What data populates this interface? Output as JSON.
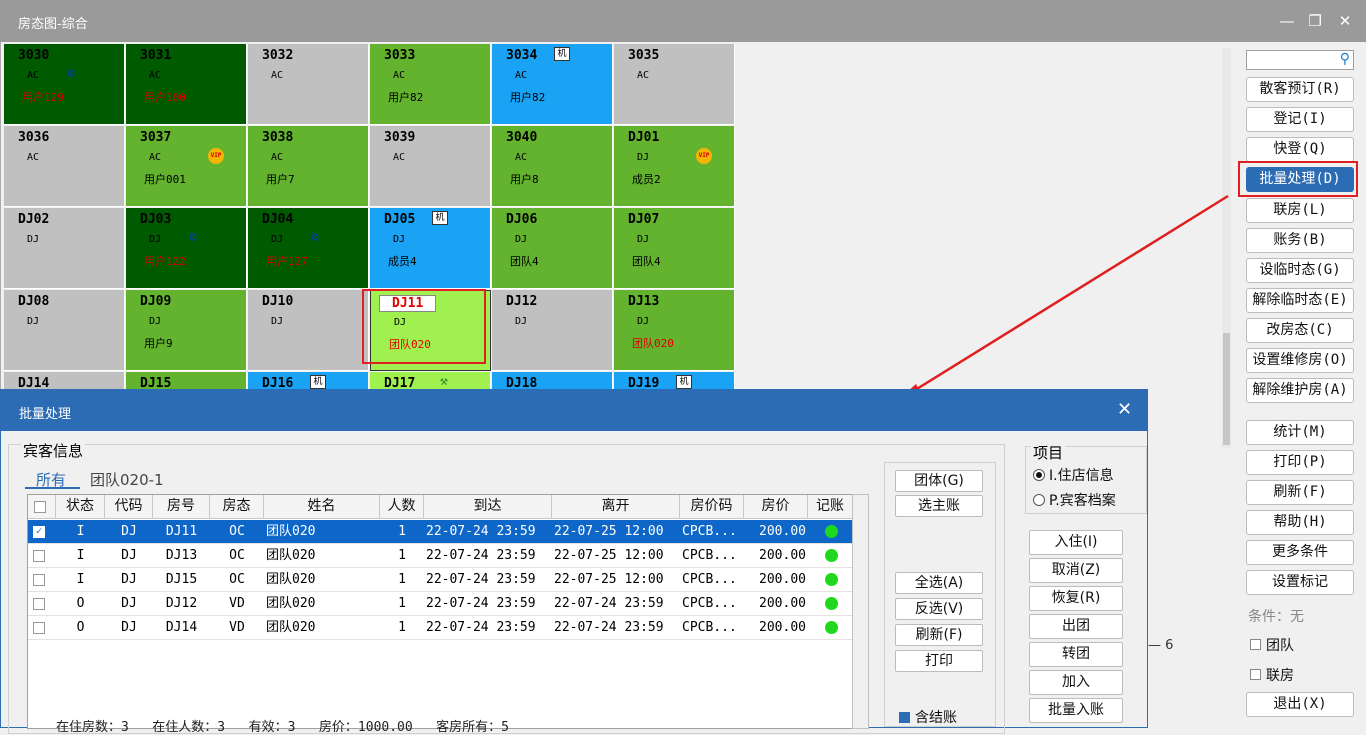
{
  "window": {
    "title": "房态图-综合",
    "minimize_icon": "minimize-icon",
    "restore_icon": "restore-icon",
    "close_icon": "close-icon"
  },
  "colors": {
    "occupied_dark": "#005a00",
    "occupied": "#63b32e",
    "vacant": "#c0c0c0",
    "reserved": "#1aa3f4",
    "selected": "#a0f050",
    "accent": "#2b6cb5",
    "highlight": "#e02020"
  },
  "rooms": [
    {
      "no": "3030",
      "type": "AC",
      "guest": "用户129",
      "color": "dark",
      "icon": "gear"
    },
    {
      "no": "3031",
      "type": "AC",
      "guest": "用户100",
      "color": "dark",
      "icon": ""
    },
    {
      "no": "3032",
      "type": "AC",
      "guest": "",
      "color": "gray",
      "icon": ""
    },
    {
      "no": "3033",
      "type": "AC",
      "guest": "用户82",
      "color": "green",
      "icon": ""
    },
    {
      "no": "3034",
      "type": "AC",
      "guest": "用户82",
      "color": "blue",
      "icon": "machine"
    },
    {
      "no": "3035",
      "type": "AC",
      "guest": "",
      "color": "gray",
      "icon": ""
    },
    {
      "no": "3036",
      "type": "AC",
      "guest": "",
      "color": "gray",
      "icon": ""
    },
    {
      "no": "3037",
      "type": "AC",
      "guest": "用户001",
      "color": "green",
      "icon": "vip"
    },
    {
      "no": "3038",
      "type": "AC",
      "guest": "用户7",
      "color": "green",
      "icon": ""
    },
    {
      "no": "3039",
      "type": "AC",
      "guest": "",
      "color": "gray",
      "icon": ""
    },
    {
      "no": "3040",
      "type": "AC",
      "guest": "用户8",
      "color": "green",
      "icon": ""
    },
    {
      "no": "DJ01",
      "type": "DJ",
      "guest": "成员2",
      "color": "green",
      "icon": "vip"
    },
    {
      "no": "DJ02",
      "type": "DJ",
      "guest": "",
      "color": "gray",
      "icon": ""
    },
    {
      "no": "DJ03",
      "type": "DJ",
      "guest": "用户122",
      "color": "dark",
      "icon": "gear"
    },
    {
      "no": "DJ04",
      "type": "DJ",
      "guest": "用户127",
      "color": "dark",
      "icon": "gear"
    },
    {
      "no": "DJ05",
      "type": "DJ",
      "guest": "成员4",
      "color": "blue",
      "icon": "machine"
    },
    {
      "no": "DJ06",
      "type": "DJ",
      "guest": "团队4",
      "color": "green",
      "icon": ""
    },
    {
      "no": "DJ07",
      "type": "DJ",
      "guest": "团队4",
      "color": "green",
      "icon": ""
    },
    {
      "no": "DJ08",
      "type": "DJ",
      "guest": "",
      "color": "gray",
      "icon": ""
    },
    {
      "no": "DJ09",
      "type": "DJ",
      "guest": "用户9",
      "color": "green",
      "icon": ""
    },
    {
      "no": "DJ10",
      "type": "DJ",
      "guest": "",
      "color": "gray",
      "icon": ""
    },
    {
      "no": "DJ11",
      "type": "DJ",
      "guest": "团队020",
      "color": "lime",
      "icon": "",
      "red_guest": true
    },
    {
      "no": "DJ12",
      "type": "DJ",
      "guest": "",
      "color": "gray",
      "icon": ""
    },
    {
      "no": "DJ13",
      "type": "DJ",
      "guest": "团队020",
      "color": "green",
      "icon": "",
      "red_guest": true
    },
    {
      "no": "DJ14",
      "type": "",
      "guest": "",
      "color": "gray",
      "icon": ""
    },
    {
      "no": "DJ15",
      "type": "",
      "guest": "",
      "color": "green",
      "icon": ""
    },
    {
      "no": "DJ16",
      "type": "",
      "guest": "",
      "color": "blue",
      "icon": "machine"
    },
    {
      "no": "DJ17",
      "type": "",
      "guest": "",
      "color": "lime",
      "icon": "broom"
    },
    {
      "no": "DJ18",
      "type": "",
      "guest": "",
      "color": "blue",
      "icon": ""
    },
    {
      "no": "DJ19",
      "type": "",
      "guest": "",
      "color": "blue",
      "icon": "machine"
    }
  ],
  "sidebar": {
    "search_icon": "search-icon",
    "buttons": [
      "散客预订(R)",
      "登记(I)",
      "快登(Q)",
      "批量处理(D)",
      "联房(L)",
      "账务(B)",
      "设临时态(G)",
      "解除临时态(E)",
      "改房态(C)",
      "设置维修房(O)",
      "解除维护房(A)",
      "统计(M)",
      "打印(P)",
      "刷新(F)",
      "帮助(H)",
      "更多条件",
      "设置标记"
    ],
    "selected_index": 3,
    "condition": "条件：无",
    "checks": [
      "团队",
      "联房"
    ],
    "exit": "退出(X)"
  },
  "background_text": "— 6",
  "dialog": {
    "title": "批量处理",
    "close_icon": "close-icon",
    "guest_info_label": "宾客信息",
    "tabs": [
      "所有",
      "团队020-1"
    ],
    "columns": [
      "状态",
      "代码",
      "房号",
      "房态",
      "姓名",
      "人数",
      "到达",
      "离开",
      "房价码",
      "房价",
      "记账"
    ],
    "rows": [
      {
        "checked": true,
        "status": "I",
        "code": "DJ",
        "room": "DJ11",
        "state": "OC",
        "name": "团队020",
        "people": "1",
        "arrive": "22-07-24 23:59",
        "leave": "22-07-25 12:00",
        "rate_code": "CPCB...",
        "rate": "200.00",
        "posting": "green"
      },
      {
        "checked": false,
        "status": "I",
        "code": "DJ",
        "room": "DJ13",
        "state": "OC",
        "name": "团队020",
        "people": "1",
        "arrive": "22-07-24 23:59",
        "leave": "22-07-25 12:00",
        "rate_code": "CPCB...",
        "rate": "200.00",
        "posting": "green"
      },
      {
        "checked": false,
        "status": "I",
        "code": "DJ",
        "room": "DJ15",
        "state": "OC",
        "name": "团队020",
        "people": "1",
        "arrive": "22-07-24 23:59",
        "leave": "22-07-25 12:00",
        "rate_code": "CPCB...",
        "rate": "200.00",
        "posting": "green"
      },
      {
        "checked": false,
        "status": "O",
        "code": "DJ",
        "room": "DJ12",
        "state": "VD",
        "name": "团队020",
        "people": "1",
        "arrive": "22-07-24 23:59",
        "leave": "22-07-24 23:59",
        "rate_code": "CPCB...",
        "rate": "200.00",
        "posting": "green"
      },
      {
        "checked": false,
        "status": "O",
        "code": "DJ",
        "room": "DJ14",
        "state": "VD",
        "name": "团队020",
        "people": "1",
        "arrive": "22-07-24 23:59",
        "leave": "22-07-24 23:59",
        "rate_code": "CPCB...",
        "rate": "200.00",
        "posting": "green"
      }
    ],
    "summary": "在住房数：3   在住人数：3   有效：3   房价：1000.00   客房所有：5",
    "mid_buttons_top": [
      "团体(G)",
      "选主账"
    ],
    "mid_buttons_bottom": [
      "全选(A)",
      "反选(V)",
      "刷新(F)",
      "打印"
    ],
    "include_checkout": "含结账",
    "project_label": "项目",
    "radios": [
      "I.住店信息",
      "P.宾客档案"
    ],
    "right_buttons": [
      "入住(I)",
      "取消(Z)",
      "恢复(R)",
      "出团",
      "转团",
      "加入",
      "批量入账"
    ]
  }
}
